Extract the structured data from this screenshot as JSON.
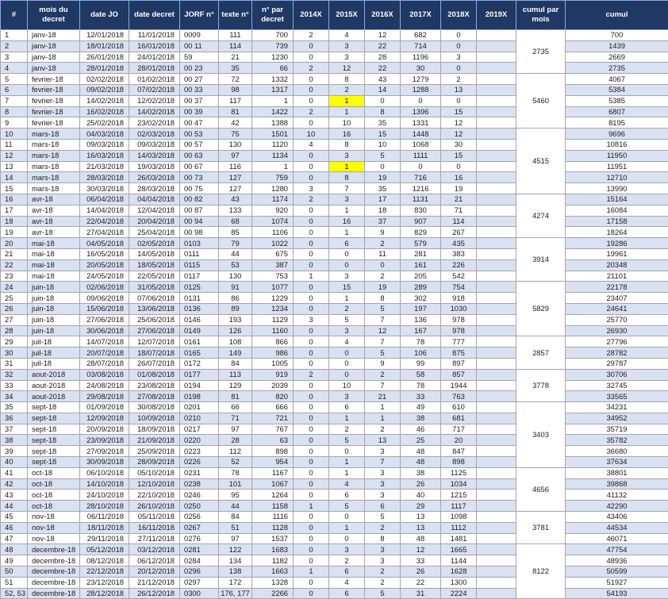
{
  "table": {
    "headers": [
      "#",
      "mois du decret",
      "date JO",
      "date decret",
      "JORF n°",
      "texte n°",
      "n° par decret",
      "2014X",
      "2015X",
      "2016X",
      "2017X",
      "2018X",
      "2019X",
      "cumul par mois",
      "cumul"
    ],
    "rows": [
      [
        "1",
        "janv-18",
        "12/01/2018",
        "11/01/2018",
        "0009",
        "111",
        "700",
        "2",
        "4",
        "12",
        "682",
        "0",
        "",
        "700"
      ],
      [
        "2",
        "janv-18",
        "18/01/2018",
        "16/01/2018",
        "00 11",
        "114",
        "739",
        "0",
        "3",
        "22",
        "714",
        "0",
        "",
        "1439"
      ],
      [
        "3",
        "janv-18",
        "26/01/2018",
        "24/01/2018",
        "59",
        "21",
        "1230",
        "0",
        "3",
        "28",
        "1196",
        "3",
        "",
        "2669"
      ],
      [
        "4",
        "janv-18",
        "28/01/2018",
        "28/01/2018",
        "00 23",
        "35",
        "66",
        "2",
        "12",
        "22",
        "30",
        "0",
        "",
        "2735"
      ],
      [
        "5",
        "fevrier-18",
        "02/02/2018",
        "01/02/2018",
        "00 27",
        "72",
        "1332",
        "0",
        "8",
        "43",
        "1279",
        "2",
        "",
        "4067"
      ],
      [
        "6",
        "fevrier-18",
        "09/02/2018",
        "07/02/2018",
        "00 33",
        "98",
        "1317",
        "0",
        "2",
        "14",
        "1288",
        "13",
        "",
        "5384"
      ],
      [
        "7",
        "fevrier-18",
        "14/02/2018",
        "12/02/2018",
        "00 37",
        "117",
        "1",
        "0",
        "1",
        "0",
        "0",
        "0",
        "",
        "5385"
      ],
      [
        "8",
        "fevrier-18",
        "16/02/2018",
        "14/02/2018",
        "00 39",
        "81",
        "1422",
        "2",
        "1",
        "8",
        "1396",
        "15",
        "",
        "6807"
      ],
      [
        "9",
        "fevrier-18",
        "25/02/2018",
        "23/02/2018",
        "00 47",
        "42",
        "1388",
        "0",
        "10",
        "35",
        "1331",
        "12",
        "",
        "8195"
      ],
      [
        "10",
        "mars-18",
        "04/03/2018",
        "02/03/2018",
        "00 53",
        "75",
        "1501",
        "10",
        "16",
        "15",
        "1448",
        "12",
        "",
        "9696"
      ],
      [
        "11",
        "mars-18",
        "09/03/2018",
        "09/03/2018",
        "00 57",
        "130",
        "1120",
        "4",
        "8",
        "10",
        "1068",
        "30",
        "",
        "10816"
      ],
      [
        "12",
        "mars-18",
        "16/03/2018",
        "14/03/2018",
        "00 63",
        "97",
        "1134",
        "0",
        "3",
        "5",
        "1111",
        "15",
        "",
        "11950"
      ],
      [
        "13",
        "mars-18",
        "21/03/2018",
        "19/03/2018",
        "00 67",
        "116",
        "1",
        "0",
        "1",
        "0",
        "0",
        "0",
        "",
        "11951"
      ],
      [
        "14",
        "mars-18",
        "28/03/2018",
        "26/03/2018",
        "00 73",
        "127",
        "759",
        "0",
        "8",
        "19",
        "716",
        "16",
        "",
        "12710"
      ],
      [
        "15",
        "mars-18",
        "30/03/2018",
        "28/03/2018",
        "00 75",
        "127",
        "1280",
        "3",
        "7",
        "35",
        "1216",
        "19",
        "",
        "13990"
      ],
      [
        "16",
        "avr-18",
        "06/04/2018",
        "04/04/2018",
        "00 82",
        "43",
        "1174",
        "2",
        "3",
        "17",
        "1131",
        "21",
        "",
        "15164"
      ],
      [
        "17",
        "avr-18",
        "14/04/2018",
        "12/04/2018",
        "00 87",
        "133",
        "920",
        "0",
        "1",
        "18",
        "830",
        "71",
        "",
        "16084"
      ],
      [
        "18",
        "avr-18",
        "22/04/2018",
        "20/04/2018",
        "00 94",
        "68",
        "1074",
        "0",
        "16",
        "37",
        "907",
        "114",
        "",
        "17158"
      ],
      [
        "19",
        "avr-18",
        "27/04/2018",
        "25/04/2018",
        "00 98",
        "85",
        "1106",
        "0",
        "1",
        "9",
        "829",
        "267",
        "",
        "18264"
      ],
      [
        "20",
        "mai-18",
        "04/05/2018",
        "02/05/2018",
        "0103",
        "79",
        "1022",
        "0",
        "6",
        "2",
        "579",
        "435",
        "",
        "19286"
      ],
      [
        "21",
        "mai-18",
        "16/05/2018",
        "14/05/2018",
        "0111",
        "44",
        "675",
        "0",
        "0",
        "11",
        "281",
        "383",
        "",
        "19961"
      ],
      [
        "22",
        "mai-18",
        "20/05/2018",
        "18/05/2018",
        "0115",
        "53",
        "387",
        "0",
        "0",
        "0",
        "161",
        "226",
        "",
        "20348"
      ],
      [
        "23",
        "mai-18",
        "24/05/2018",
        "22/05/2018",
        "0117",
        "130",
        "753",
        "1",
        "3",
        "2",
        "205",
        "542",
        "",
        "21101"
      ],
      [
        "24",
        "juin-18",
        "02/06/2018",
        "31/05/2018",
        "0125",
        "91",
        "1077",
        "0",
        "15",
        "19",
        "289",
        "754",
        "",
        "22178"
      ],
      [
        "25",
        "juin-18",
        "09/06/2018",
        "07/06/2018",
        "0131",
        "86",
        "1229",
        "0",
        "1",
        "8",
        "302",
        "918",
        "",
        "23407"
      ],
      [
        "26",
        "juin-18",
        "15/06/2018",
        "13/06/2018",
        "0136",
        "89",
        "1234",
        "0",
        "2",
        "5",
        "197",
        "1030",
        "",
        "24641"
      ],
      [
        "27",
        "juin-18",
        "27/06/2018",
        "25/06/2018",
        "0146",
        "193",
        "1129",
        "3",
        "5",
        "7",
        "136",
        "978",
        "",
        "25770"
      ],
      [
        "28",
        "juin-18",
        "30/06/2018",
        "27/06/2018",
        "0149",
        "126",
        "1160",
        "0",
        "3",
        "12",
        "167",
        "978",
        "",
        "26930"
      ],
      [
        "29",
        "juil-18",
        "14/07/2018",
        "12/07/2018",
        "0161",
        "108",
        "866",
        "0",
        "4",
        "7",
        "78",
        "777",
        "",
        "27796"
      ],
      [
        "30",
        "juil-18",
        "20/07/2018",
        "18/07/2018",
        "0165",
        "149",
        "986",
        "0",
        "0",
        "5",
        "106",
        "875",
        "",
        "28782"
      ],
      [
        "31",
        "juil-18",
        "28/07/2018",
        "26/07/2018",
        "0172",
        "84",
        "1005",
        "0",
        "0",
        "9",
        "99",
        "897",
        "",
        "29787"
      ],
      [
        "32",
        "aout-2018",
        "03/08/2018",
        "01/08/2018",
        "0177",
        "113",
        "919",
        "2",
        "0",
        "2",
        "58",
        "857",
        "",
        "30706"
      ],
      [
        "33",
        "aout-2018",
        "24/08/2018",
        "23/08/2018",
        "0194",
        "129",
        "2039",
        "0",
        "10",
        "7",
        "78",
        "1944",
        "",
        "32745"
      ],
      [
        "34",
        "aout-2018",
        "29/08/2018",
        "27/08/2018",
        "0198",
        "81",
        "820",
        "0",
        "3",
        "21",
        "33",
        "763",
        "",
        "33565"
      ],
      [
        "35",
        "sept-18",
        "01/09/2018",
        "30/08/2018",
        "0201",
        "66",
        "666",
        "0",
        "6",
        "1",
        "49",
        "610",
        "",
        "34231"
      ],
      [
        "36",
        "sept-18",
        "12/09/2018",
        "10/09/2018",
        "0210",
        "71",
        "721",
        "0",
        "1",
        "1",
        "38",
        "681",
        "",
        "34952"
      ],
      [
        "37",
        "sept-18",
        "20/09/2018",
        "18/09/2018",
        "0217",
        "97",
        "767",
        "0",
        "2",
        "2",
        "46",
        "717",
        "",
        "35719"
      ],
      [
        "38",
        "sept-18",
        "23/09/2018",
        "21/09/2018",
        "0220",
        "28",
        "63",
        "0",
        "5",
        "13",
        "25",
        "20",
        "",
        "35782"
      ],
      [
        "39",
        "sept-18",
        "27/09/2018",
        "25/09/2018",
        "0223",
        "112",
        "898",
        "0",
        "0",
        "3",
        "48",
        "847",
        "",
        "36680"
      ],
      [
        "40",
        "sept-18",
        "30/09/2018",
        "28/09/2018",
        "0226",
        "52",
        "954",
        "0",
        "1",
        "7",
        "48",
        "898",
        "",
        "37634"
      ],
      [
        "41",
        "oct-18",
        "06/10/2018",
        "05/10/2018",
        "0231",
        "78",
        "1167",
        "0",
        "1",
        "3",
        "38",
        "1125",
        "",
        "38801"
      ],
      [
        "42",
        "oct-18",
        "14/10/2018",
        "12/10/2018",
        "0238",
        "101",
        "1067",
        "0",
        "4",
        "3",
        "26",
        "1034",
        "",
        "39868"
      ],
      [
        "43",
        "oct-18",
        "24/10/2018",
        "22/10/2018",
        "0246",
        "95",
        "1264",
        "0",
        "6",
        "3",
        "40",
        "1215",
        "",
        "41132"
      ],
      [
        "44",
        "oct-18",
        "28/10/2018",
        "26/10/2018",
        "0250",
        "44",
        "1158",
        "1",
        "5",
        "6",
        "29",
        "1117",
        "",
        "42290"
      ],
      [
        "45",
        "nov-18",
        "06/11/2018",
        "05/11/2018",
        "0256",
        "84",
        "1116",
        "0",
        "0",
        "5",
        "13",
        "1098",
        "",
        "43406"
      ],
      [
        "46",
        "nov-18",
        "18/11/2018",
        "16/11/2018",
        "0267",
        "51",
        "1128",
        "0",
        "1",
        "2",
        "13",
        "1112",
        "",
        "44534"
      ],
      [
        "47",
        "nov-18",
        "29/11/2018",
        "27/11/2018",
        "0276",
        "97",
        "1537",
        "0",
        "0",
        "8",
        "48",
        "1481",
        "",
        "46071"
      ],
      [
        "48",
        "decembre-18",
        "05/12/2018",
        "03/12/2018",
        "0281",
        "122",
        "1683",
        "0",
        "3",
        "3",
        "12",
        "1665",
        "",
        "47754"
      ],
      [
        "49",
        "decembre-18",
        "08/12/2018",
        "06/12/2018",
        "0284",
        "134",
        "1182",
        "0",
        "2",
        "3",
        "33",
        "1144",
        "",
        "48936"
      ],
      [
        "50",
        "decembre-18",
        "22/12/2018",
        "20/12/2018",
        "0296",
        "138",
        "1663",
        "1",
        "6",
        "2",
        "26",
        "1628",
        "",
        "50599"
      ],
      [
        "51",
        "decembre-18",
        "23/12/2018",
        "21/12/2018",
        "0297",
        "172",
        "1328",
        "0",
        "4",
        "2",
        "22",
        "1300",
        "",
        "51927"
      ],
      [
        "52, 53",
        "decembre-18",
        "28/12/2018",
        "26/12/2018",
        "0300",
        "176, 177",
        "2266",
        "0",
        "6",
        "5",
        "31",
        "2224",
        "",
        "54193"
      ]
    ],
    "month_totals": [
      {
        "value": "2735",
        "start": 0,
        "span": 4
      },
      {
        "value": "5460",
        "start": 4,
        "span": 5
      },
      {
        "value": "4515",
        "start": 9,
        "span": 6
      },
      {
        "value": "4274",
        "start": 15,
        "span": 4
      },
      {
        "value": "3914",
        "start": 19,
        "span": 4
      },
      {
        "value": "5829",
        "start": 23,
        "span": 5
      },
      {
        "value": "2857",
        "start": 28,
        "span": 3
      },
      {
        "value": "3778",
        "start": 31,
        "span": 3
      },
      {
        "value": "3403",
        "start": 34,
        "span": 6
      },
      {
        "value": "4656",
        "start": 40,
        "span": 4
      },
      {
        "value": "3781",
        "start": 44,
        "span": 3
      },
      {
        "value": "8122",
        "start": 47,
        "span": 5
      }
    ],
    "highlighted_cells": [
      {
        "row": 6,
        "col": 8
      },
      {
        "row": 12,
        "col": 8
      }
    ],
    "highlight_color": "#ffff00",
    "header_color": "#1f3864",
    "band_color": "#d9e1f2"
  }
}
